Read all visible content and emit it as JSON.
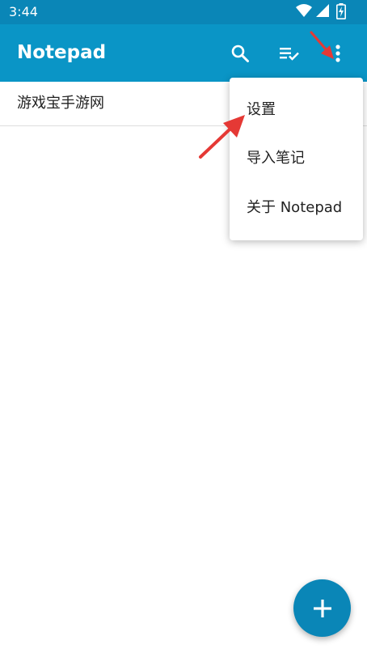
{
  "status_bar": {
    "time": "3:44",
    "icons": [
      "wifi-icon",
      "cellular-signal-icon",
      "battery-charging-icon"
    ]
  },
  "app_bar": {
    "title": "Notepad",
    "actions": [
      "search-icon",
      "sort-icon",
      "more-options-icon"
    ]
  },
  "notes": [
    {
      "title": "游戏宝手游网"
    }
  ],
  "overflow_menu": {
    "items": [
      {
        "label": "设置"
      },
      {
        "label": "导入笔记"
      },
      {
        "label": "关于 Notepad"
      }
    ]
  },
  "fab": {
    "icon": "plus-icon"
  },
  "colors": {
    "status_bar": "#0a86b7",
    "app_bar": "#0a95c6",
    "fab": "#0a86b7",
    "annotation_arrow": "#e53935"
  }
}
